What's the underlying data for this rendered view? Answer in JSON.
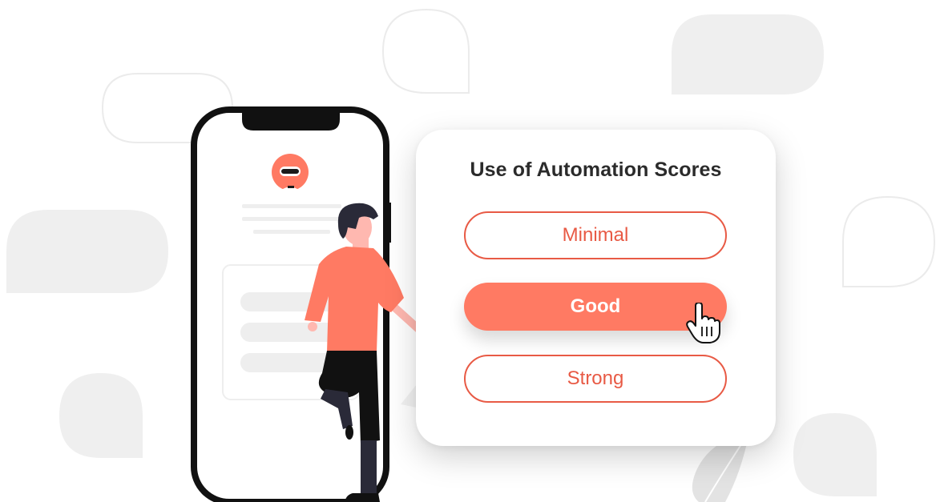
{
  "card": {
    "title": "Use of Automation Scores",
    "options": [
      {
        "label": "Minimal",
        "selected": false
      },
      {
        "label": "Good",
        "selected": true
      },
      {
        "label": "Strong",
        "selected": false
      }
    ]
  },
  "colors": {
    "accent": "#ff7a63",
    "accent_border": "#e85a45",
    "text_dark": "#2b2b2b",
    "background_shapes": "#efefef"
  },
  "icons": [
    "robot-avatar-icon",
    "hand-pointer-cursor-icon"
  ]
}
